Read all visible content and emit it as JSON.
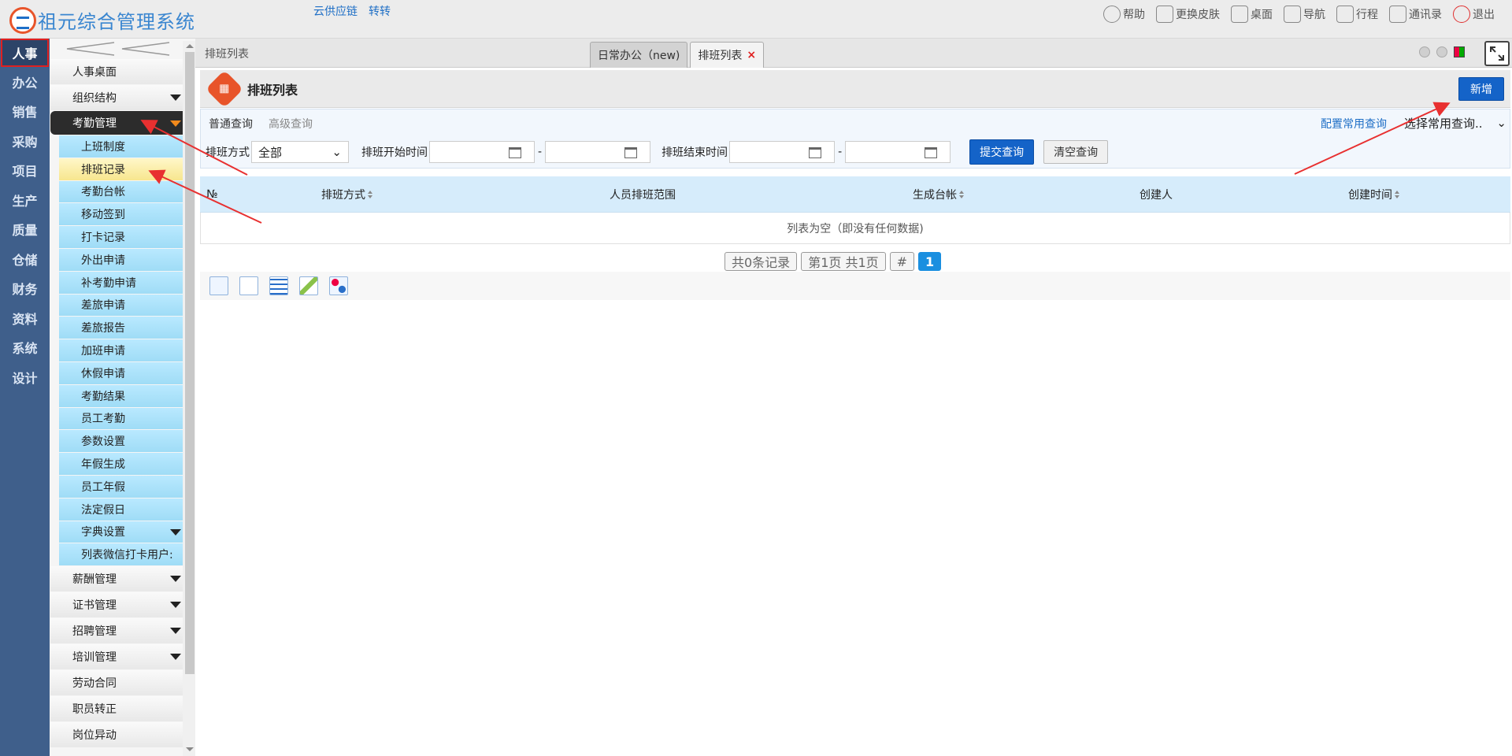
{
  "app": {
    "title": "祖元综合管理系统",
    "top_links": [
      "云供应链",
      "转转"
    ],
    "top_nav": [
      {
        "label": "帮助",
        "icon": "help-icon"
      },
      {
        "label": "更换皮肤",
        "icon": "shirt-icon"
      },
      {
        "label": "桌面",
        "icon": "home-icon"
      },
      {
        "label": "导航",
        "icon": "grid-icon"
      },
      {
        "label": "行程",
        "icon": "calendar-icon"
      },
      {
        "label": "通讯录",
        "icon": "contacts-icon"
      },
      {
        "label": "退出",
        "icon": "power-icon"
      }
    ]
  },
  "rail": {
    "items": [
      "人事",
      "办公",
      "销售",
      "采购",
      "项目",
      "生产",
      "质量",
      "仓储",
      "财务",
      "资料",
      "系统",
      "设计"
    ],
    "active": "人事"
  },
  "submenu": {
    "collapse_label": "<<",
    "items": [
      {
        "label": "人事桌面",
        "type": "menu"
      },
      {
        "label": "组织结构",
        "type": "menu",
        "caret": true
      },
      {
        "label": "考勤管理",
        "type": "menu-open",
        "caret": true
      },
      {
        "label": "上班制度",
        "type": "sub"
      },
      {
        "label": "排班记录",
        "type": "sub-active"
      },
      {
        "label": "考勤台帐",
        "type": "sub"
      },
      {
        "label": "移动签到",
        "type": "sub"
      },
      {
        "label": "打卡记录",
        "type": "sub"
      },
      {
        "label": "外出申请",
        "type": "sub"
      },
      {
        "label": "补考勤申请",
        "type": "sub"
      },
      {
        "label": "差旅申请",
        "type": "sub"
      },
      {
        "label": "差旅报告",
        "type": "sub"
      },
      {
        "label": "加班申请",
        "type": "sub"
      },
      {
        "label": "休假申请",
        "type": "sub"
      },
      {
        "label": "考勤结果",
        "type": "sub"
      },
      {
        "label": "员工考勤",
        "type": "sub"
      },
      {
        "label": "参数设置",
        "type": "sub"
      },
      {
        "label": "年假生成",
        "type": "sub"
      },
      {
        "label": "员工年假",
        "type": "sub"
      },
      {
        "label": "法定假日",
        "type": "sub"
      },
      {
        "label": "字典设置",
        "type": "sub",
        "caret": true
      },
      {
        "label": "列表微信打卡用户:",
        "type": "sub"
      },
      {
        "label": "薪酬管理",
        "type": "menu",
        "caret": true
      },
      {
        "label": "证书管理",
        "type": "menu",
        "caret": true
      },
      {
        "label": "招聘管理",
        "type": "menu",
        "caret": true
      },
      {
        "label": "培训管理",
        "type": "menu",
        "caret": true
      },
      {
        "label": "劳动合同",
        "type": "menu"
      },
      {
        "label": "职员转正",
        "type": "menu"
      },
      {
        "label": "岗位异动",
        "type": "menu"
      }
    ]
  },
  "tabs": {
    "breadcrumb": "排班列表",
    "items": [
      {
        "label": "日常办公（new)",
        "active": false
      },
      {
        "label": "排班列表",
        "active": true,
        "closable": true
      }
    ]
  },
  "page": {
    "title": "排班列表",
    "new_button": "新增"
  },
  "query": {
    "tab_normal": "普通查询",
    "tab_advanced": "高级查询",
    "config_link": "配置常用查询",
    "common_select": "选择常用查询..",
    "mode_label": "排班方式",
    "mode_value": "全部",
    "start_label": "排班开始时间",
    "end_label": "排班结束时间",
    "dash": "-",
    "submit": "提交查询",
    "clear": "清空查询"
  },
  "table": {
    "columns": [
      "№",
      "排班方式",
      "人员排班范围",
      "生成台帐",
      "创建人",
      "创建时间"
    ],
    "empty_text": "列表为空（即没有任何数据)"
  },
  "pager": {
    "total": "共0条记录",
    "page_info": "第1页 共1页",
    "hash": "#",
    "current": "1"
  },
  "colors": {
    "rail_bg": "#3f5f8b",
    "accent": "#1463c8",
    "annotation": "#e83030"
  }
}
